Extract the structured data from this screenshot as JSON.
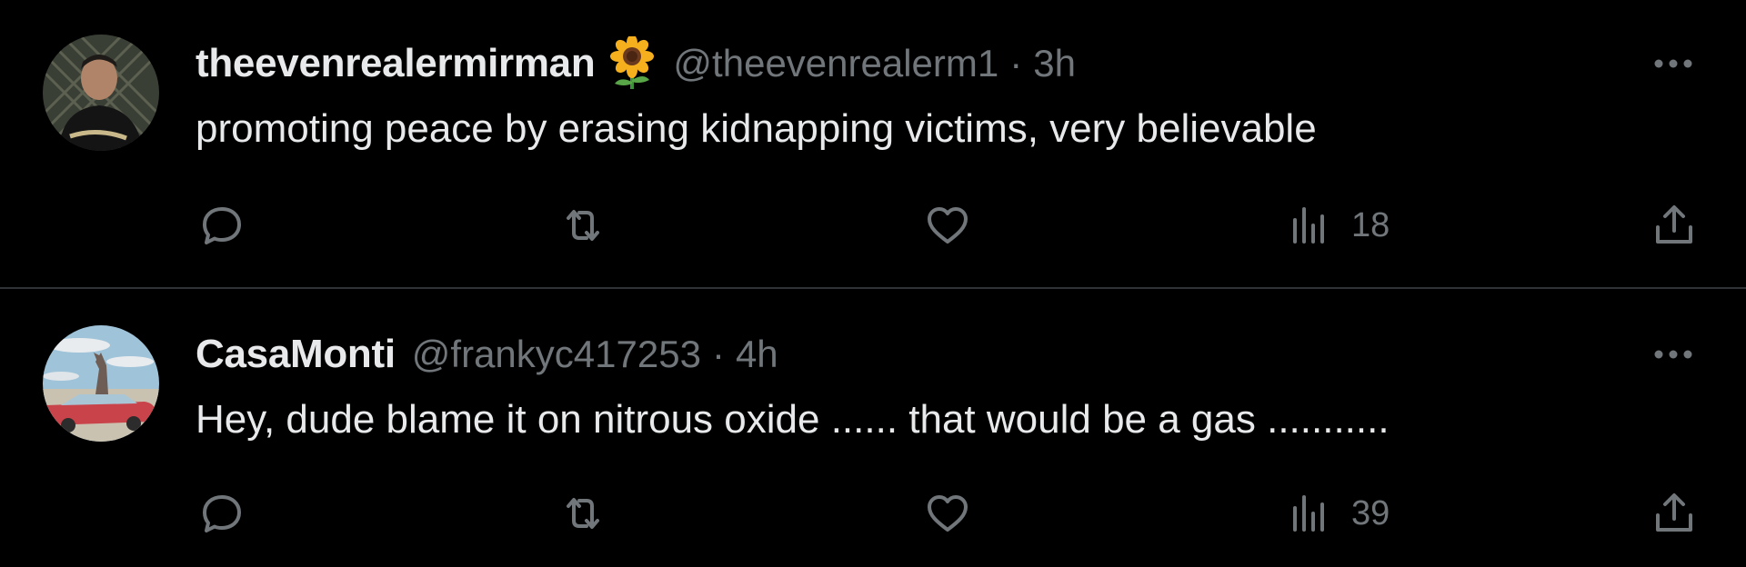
{
  "tweets": [
    {
      "display_name": "theevenrealermirman",
      "badge": "sunflower-emoji",
      "handle": "@theevenrealerm1",
      "separator": "·",
      "time": "3h",
      "text": "promoting peace by erasing kidnapping victims, very believable",
      "views": "18"
    },
    {
      "display_name": "CasaMonti",
      "handle": "@frankyc417253",
      "separator": "·",
      "time": "4h",
      "text": "Hey, dude blame it on nitrous oxide ...... that would be a gas ...........",
      "views": "39"
    }
  ],
  "colors": {
    "background": "#000000",
    "primary_text": "#e7e9ea",
    "secondary_text": "#71767b",
    "divider": "#2f3336"
  },
  "icons": {
    "more": "more-horizontal-icon",
    "reply": "reply-bubble-icon",
    "retweet": "retweet-icon",
    "like": "heart-icon",
    "views": "views-bar-chart-icon",
    "share": "share-upload-icon"
  }
}
